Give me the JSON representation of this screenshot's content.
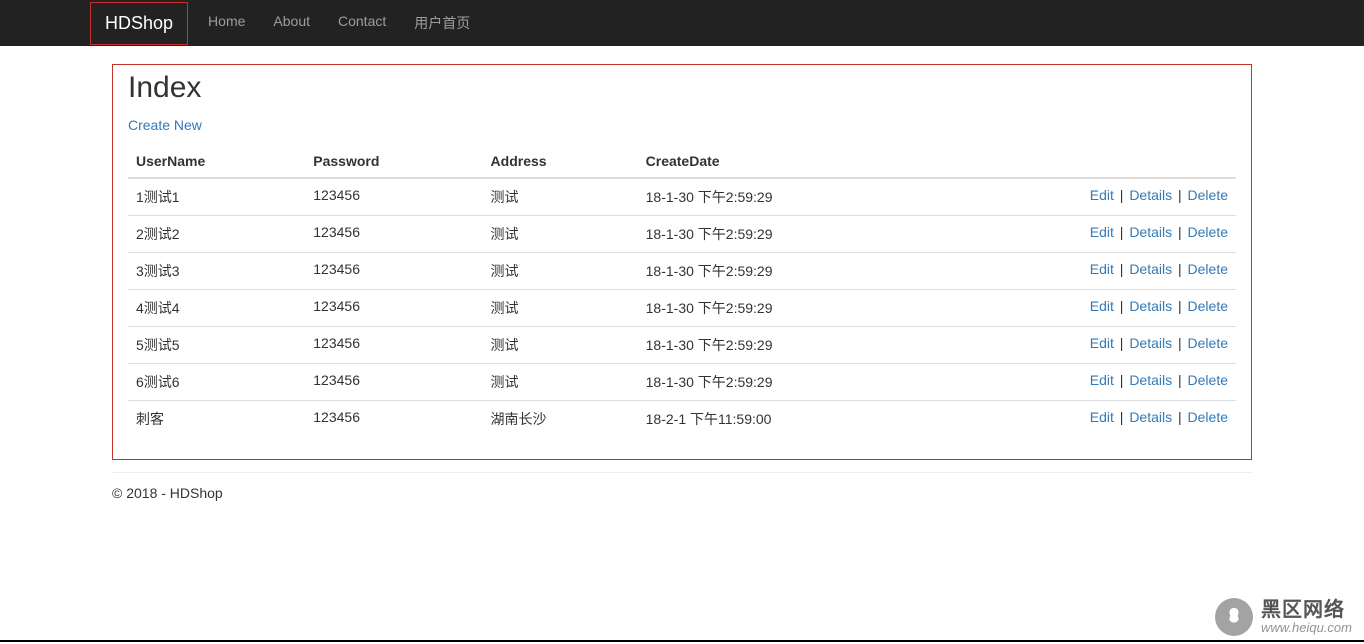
{
  "nav": {
    "brand": "HDShop",
    "items": [
      "Home",
      "About",
      "Contact",
      "用户首页"
    ]
  },
  "page": {
    "title": "Index",
    "create_link": "Create New"
  },
  "table": {
    "headers": {
      "username": "UserName",
      "password": "Password",
      "address": "Address",
      "createdate": "CreateDate"
    },
    "actions": {
      "edit": "Edit",
      "details": "Details",
      "delete": "Delete"
    },
    "rows": [
      {
        "username": "1测试1",
        "password": "123456",
        "address": "测试",
        "createdate": "18-1-30 下午2:59:29"
      },
      {
        "username": "2测试2",
        "password": "123456",
        "address": "测试",
        "createdate": "18-1-30 下午2:59:29"
      },
      {
        "username": "3测试3",
        "password": "123456",
        "address": "测试",
        "createdate": "18-1-30 下午2:59:29"
      },
      {
        "username": "4测试4",
        "password": "123456",
        "address": "测试",
        "createdate": "18-1-30 下午2:59:29"
      },
      {
        "username": "5测试5",
        "password": "123456",
        "address": "测试",
        "createdate": "18-1-30 下午2:59:29"
      },
      {
        "username": "6测试6",
        "password": "123456",
        "address": "测试",
        "createdate": "18-1-30 下午2:59:29"
      },
      {
        "username": "刺客",
        "password": "123456",
        "address": "湖南长沙",
        "createdate": "18-2-1 下午11:59:00"
      }
    ]
  },
  "footer": {
    "text": "© 2018 - HDShop"
  },
  "watermark": {
    "cn": "黑区网络",
    "en": "www.heiqu.com"
  }
}
